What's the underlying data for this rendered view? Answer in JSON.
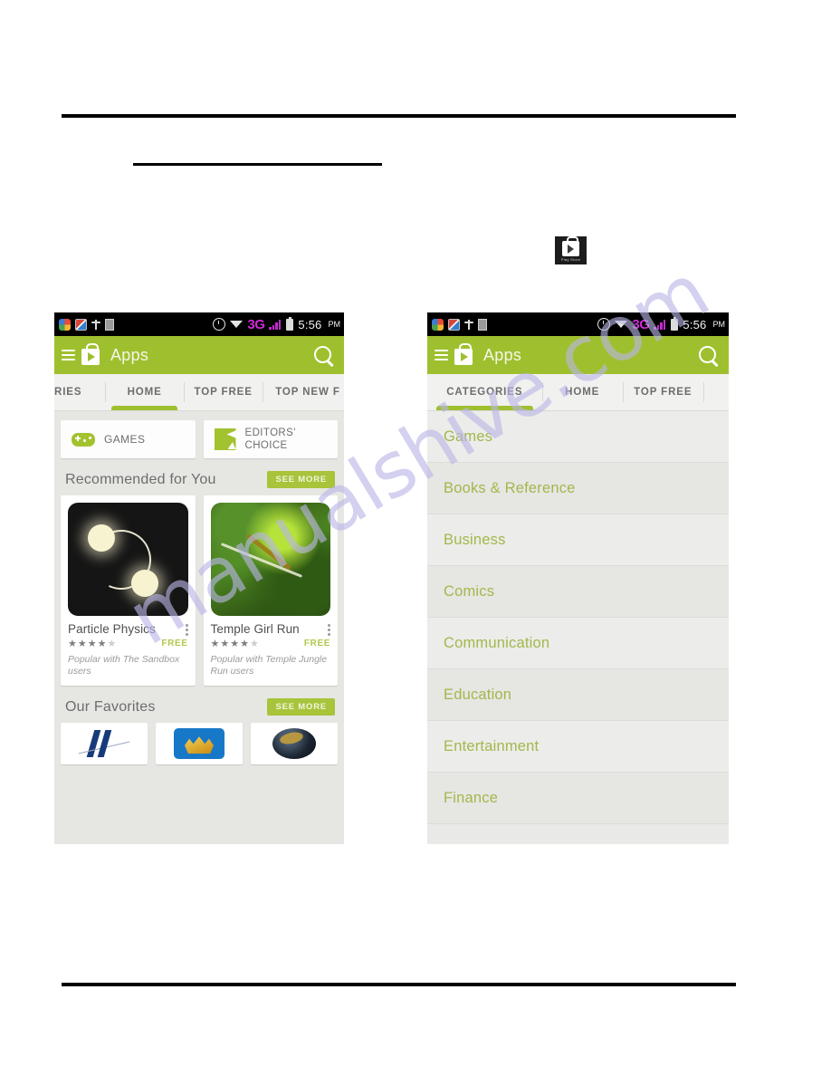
{
  "page": {
    "watermark": "manualshive.com"
  },
  "play_chip": {
    "name": "play-store-icon",
    "caption": "Play Store"
  },
  "statusbar": {
    "icons": [
      "photos-icon",
      "gallery-icon",
      "usb-icon",
      "sim-card-icon",
      "alarm-icon",
      "wifi-icon"
    ],
    "network": "3G",
    "time": "5:56",
    "ampm": "PM"
  },
  "actionbar": {
    "title": "Apps",
    "menu_icon": "hamburger-menu-icon",
    "brand_icon": "play-store-bag-icon",
    "search_icon": "search-icon"
  },
  "left_shot": {
    "tabs": [
      {
        "label": "RIES",
        "selected": false
      },
      {
        "label": "HOME",
        "selected": true
      },
      {
        "label": "TOP FREE",
        "selected": false
      },
      {
        "label": "TOP NEW F",
        "selected": false
      }
    ],
    "chips": [
      {
        "label": "GAMES",
        "icon": "gamepad-icon"
      },
      {
        "label": "EDITORS' CHOICE",
        "line1": "EDITORS'",
        "line2": "CHOICE",
        "icon": "editors-choice-icon"
      }
    ],
    "sections": [
      {
        "title": "Recommended for You",
        "see_more": "SEE MORE"
      },
      {
        "title": "Our Favorites",
        "see_more": "SEE MORE"
      }
    ],
    "apps": [
      {
        "title": "Particle Physics",
        "stars_filled": 4,
        "stars_total": 5,
        "price": "FREE",
        "blurb": "Popular with The Sandbox users",
        "thumb": "particle-physics-thumbnail"
      },
      {
        "title": "Temple Girl Run",
        "stars_filled": 4,
        "stars_total": 5,
        "price": "FREE",
        "blurb": "Popular with Temple Jungle Run users",
        "thumb": "temple-girl-run-thumbnail"
      }
    ],
    "favorites": [
      {
        "name": "gmail-app-icon"
      },
      {
        "name": "blue-app-icon"
      },
      {
        "name": "globe-app-icon"
      }
    ]
  },
  "right_shot": {
    "tabs": [
      {
        "label": "CATEGORIES",
        "selected": true
      },
      {
        "label": "HOME",
        "selected": false
      },
      {
        "label": "TOP FREE",
        "selected": false
      },
      {
        "label": "",
        "selected": false
      }
    ],
    "categories": [
      "Games",
      "Books & Reference",
      "Business",
      "Comics",
      "Communication",
      "Education",
      "Entertainment",
      "Finance"
    ]
  },
  "colors": {
    "brand_green": "#9fc02e",
    "accent_green": "#a7c43a",
    "category_text": "#a2b84a",
    "network_magenta": "#cf2bd6",
    "watermark": "#b9b6e6"
  }
}
